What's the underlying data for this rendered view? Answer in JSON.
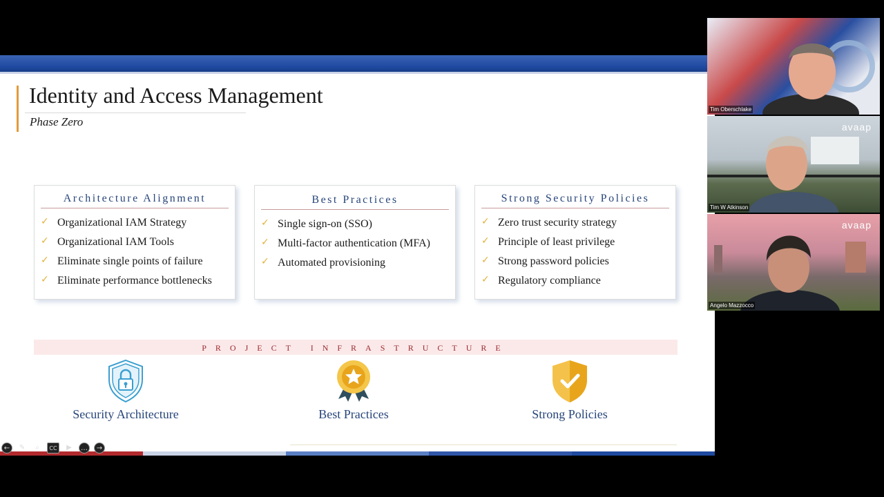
{
  "slide": {
    "title": "Identity and Access Management",
    "subtitle": "Phase Zero",
    "cards": [
      {
        "heading": "Architecture Alignment",
        "items": [
          "Organizational IAM Strategy",
          "Organizational IAM Tools",
          "Eliminate single points of  failure",
          "Eliminate performance bottlenecks"
        ]
      },
      {
        "heading": "Best Practices",
        "items": [
          "Single sign-on (SSO)",
          "Multi-factor authentication (MFA)",
          "Automated provisioning"
        ]
      },
      {
        "heading": "Strong Security Policies",
        "items": [
          "Zero trust security strategy",
          "Principle of least privilege",
          "Strong password policies",
          "Regulatory compliance"
        ]
      }
    ],
    "infrastructure_label": "PROJECT INFRASTRUCTURE",
    "infrastructure_items": [
      {
        "label": "Security Architecture",
        "icon": "shield-lock-icon"
      },
      {
        "label": "Best Practices",
        "icon": "star-medal-icon"
      },
      {
        "label": "Strong Policies",
        "icon": "shield-check-icon"
      }
    ]
  },
  "colors": {
    "accent_blue": "#1f4aa0",
    "title_accent": "#e39a3a",
    "check": "#e0b23a",
    "infra_red": "#9a2a2e"
  },
  "toolbar": [
    "prev-icon",
    "pen-icon",
    "zoom-icon",
    "captions-icon",
    "camera-icon",
    "more-icon",
    "next-icon"
  ],
  "toolbar_glyphs": {
    "prev": "←",
    "pen": "✎",
    "zoom": "⌕",
    "captions": "CC",
    "camera": "▶",
    "more": "…",
    "next": "→"
  },
  "participants": [
    {
      "name": "Tim Oberschlake",
      "brand": ""
    },
    {
      "name": "Tim W Atkinson",
      "brand": "avaap"
    },
    {
      "name": "Angelo Mazzocco",
      "brand": "avaap"
    }
  ]
}
